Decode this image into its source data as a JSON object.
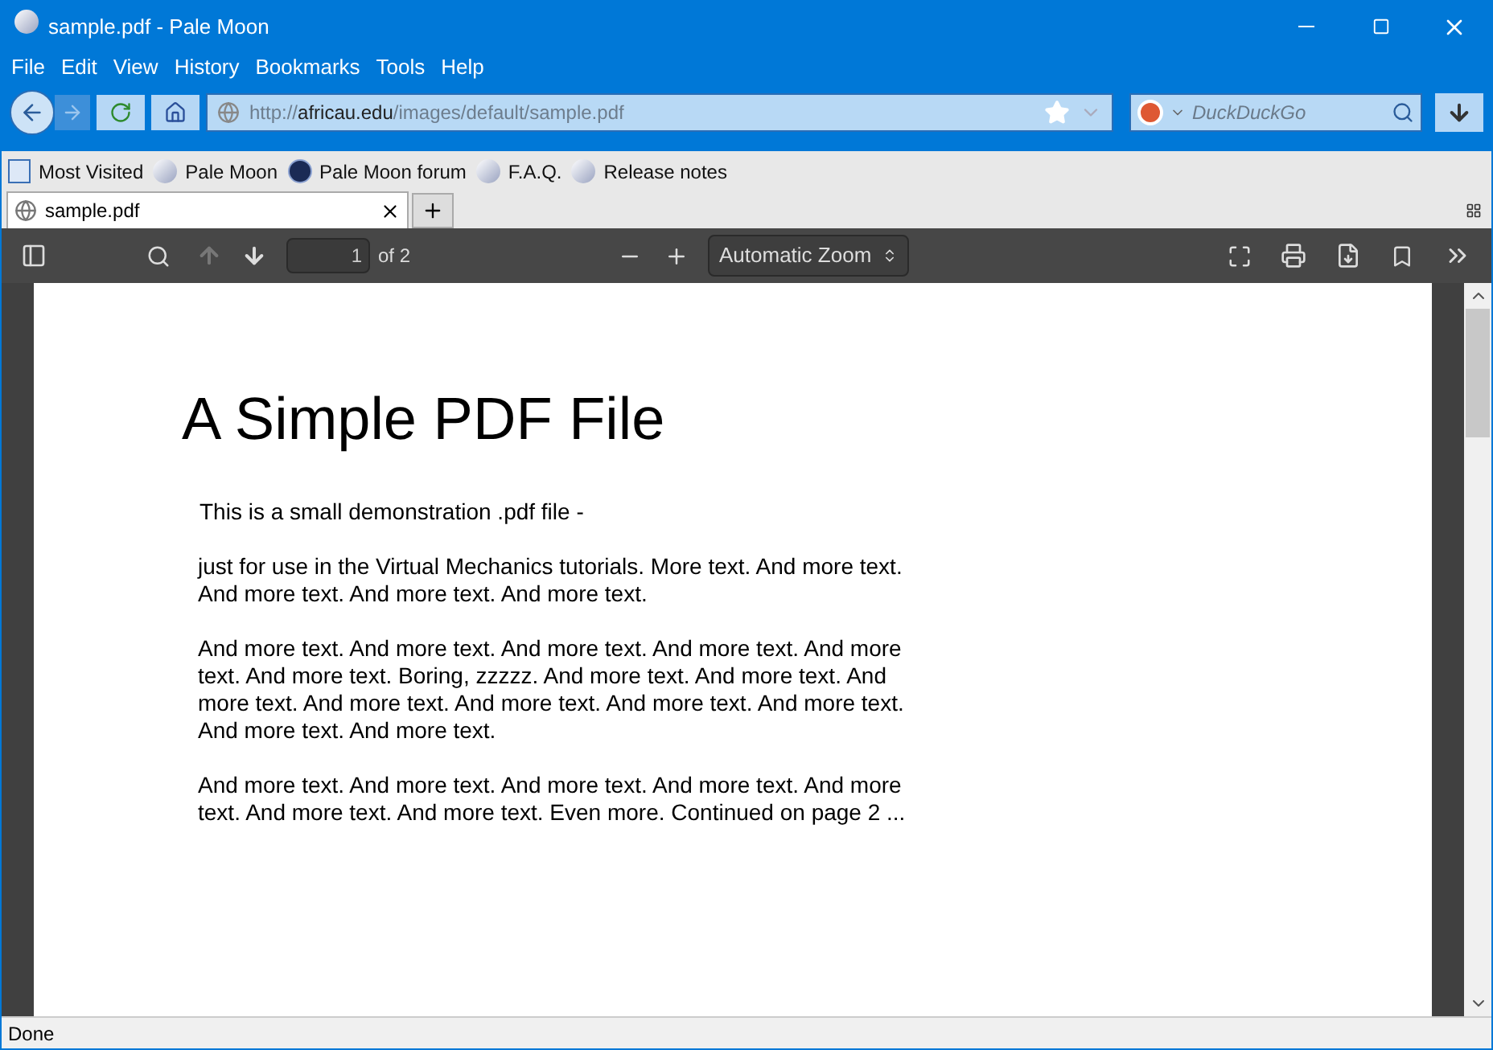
{
  "window": {
    "title": "sample.pdf - Pale Moon"
  },
  "menu": [
    {
      "label": "File"
    },
    {
      "label": "Edit"
    },
    {
      "label": "View"
    },
    {
      "label": "History"
    },
    {
      "label": "Bookmarks"
    },
    {
      "label": "Tools"
    },
    {
      "label": "Help"
    }
  ],
  "address": {
    "scheme": "http://",
    "host": "africau.edu",
    "path": "/images/default/sample.pdf"
  },
  "search": {
    "placeholder": "DuckDuckGo"
  },
  "bookmarks": [
    {
      "label": "Most Visited",
      "kind": "folder"
    },
    {
      "label": "Pale Moon",
      "kind": "moon"
    },
    {
      "label": "Pale Moon forum",
      "kind": "forum"
    },
    {
      "label": "F.A.Q.",
      "kind": "moon"
    },
    {
      "label": "Release notes",
      "kind": "moon"
    }
  ],
  "tabs": [
    {
      "label": "sample.pdf",
      "selected": true
    }
  ],
  "pdf_toolbar": {
    "page": "1",
    "page_count": "of 2",
    "zoom": "Automatic Zoom"
  },
  "document": {
    "heading": "A Simple PDF File",
    "paragraphs": [
      "This is a small demonstration .pdf file -",
      "just for use in the Virtual Mechanics tutorials. More text. And more text. And more text. And more text. And more text.",
      "And more text. And more text. And more text. And more text. And more text. And more text. Boring, zzzzz. And more text. And more text. And more text. And more text. And more text. And more text. And more text. And more text. And more text.",
      "And more text. And more text. And more text. And more text. And more text. And more text. And more text. Even more. Continued on page 2 ..."
    ]
  },
  "status_bar": "Done"
}
